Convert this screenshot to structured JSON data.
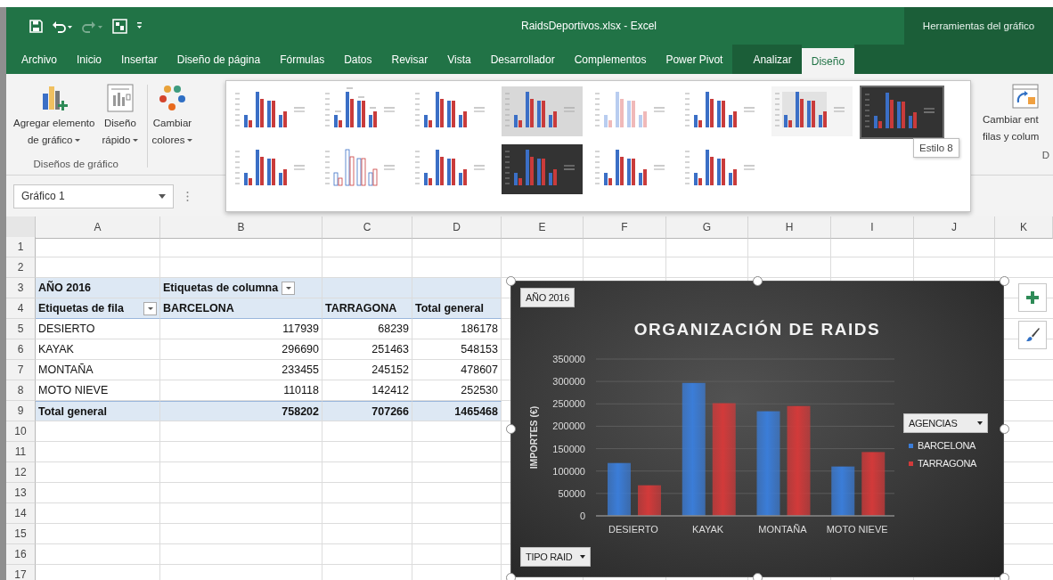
{
  "title_bar": {
    "title": "RaidsDeportivos.xlsx - Excel",
    "context_label": "Herramientas del gráfico"
  },
  "tabs": [
    {
      "label": "Archivo",
      "selected": false,
      "contextual": false
    },
    {
      "label": "Inicio",
      "selected": false,
      "contextual": false
    },
    {
      "label": "Insertar",
      "selected": false,
      "contextual": false
    },
    {
      "label": "Diseño de página",
      "selected": false,
      "contextual": false
    },
    {
      "label": "Fórmulas",
      "selected": false,
      "contextual": false
    },
    {
      "label": "Datos",
      "selected": false,
      "contextual": false
    },
    {
      "label": "Revisar",
      "selected": false,
      "contextual": false
    },
    {
      "label": "Vista",
      "selected": false,
      "contextual": false
    },
    {
      "label": "Desarrollador",
      "selected": false,
      "contextual": false
    },
    {
      "label": "Complementos",
      "selected": false,
      "contextual": false
    },
    {
      "label": "Power Pivot",
      "selected": false,
      "contextual": false
    },
    {
      "label": "Analizar",
      "selected": false,
      "contextual": true
    },
    {
      "label": "Diseño",
      "selected": true,
      "contextual": true
    }
  ],
  "ribbon": {
    "buttons": [
      {
        "kind": "add-element",
        "lines": [
          "Agregar elemento",
          "de gráfico"
        ]
      },
      {
        "kind": "quick-layout",
        "lines": [
          "Diseño",
          "rápido"
        ]
      }
    ],
    "group_label": "Diseños de gráfico",
    "colors_button": {
      "lines": [
        "Cambiar",
        "colores"
      ]
    },
    "switch_button": {
      "lines": [
        "Cambiar ent",
        "filas y colum"
      ]
    },
    "cut_group_label": "D"
  },
  "gallery": {
    "styles": [
      {
        "kind": "light",
        "selected": false
      },
      {
        "kind": "labeled",
        "selected": false
      },
      {
        "kind": "light",
        "selected": false
      },
      {
        "kind": "gradient",
        "selected": false
      },
      {
        "kind": "pale",
        "selected": false
      },
      {
        "kind": "bold",
        "selected": false
      },
      {
        "kind": "hatched",
        "selected": false
      },
      {
        "kind": "dark",
        "selected": true
      },
      {
        "kind": "light",
        "selected": false
      },
      {
        "kind": "outline",
        "selected": false
      },
      {
        "kind": "bold",
        "selected": false
      },
      {
        "kind": "dark",
        "selected": false
      },
      {
        "kind": "light",
        "selected": false
      },
      {
        "kind": "bold",
        "selected": false
      }
    ],
    "tooltip": "Estilo 8"
  },
  "formula_bar": {
    "name_box": "Gráfico 1"
  },
  "sheet": {
    "columns": [
      "A",
      "B",
      "C",
      "D",
      "E",
      "F",
      "G",
      "H",
      "I",
      "J",
      "K"
    ],
    "rows": [
      "1",
      "2",
      "3",
      "4",
      "5",
      "6",
      "7",
      "8",
      "9",
      "10",
      "11",
      "12",
      "13",
      "14",
      "15",
      "16",
      "17"
    ],
    "pivot": {
      "page_field": "AÑO 2016",
      "column_field": "Etiquetas de columna",
      "row_field": "Etiquetas de fila",
      "headers": [
        "BARCELONA",
        "TARRAGONA",
        "Total general"
      ],
      "rows": [
        {
          "label": "DESIERTO",
          "values": [
            "117939",
            "68239",
            "186178"
          ]
        },
        {
          "label": "KAYAK",
          "values": [
            "296690",
            "251463",
            "548153"
          ]
        },
        {
          "label": "MONTAÑA",
          "values": [
            "233455",
            "245152",
            "478607"
          ]
        },
        {
          "label": "MOTO NIEVE",
          "values": [
            "110118",
            "142412",
            "252530"
          ]
        }
      ],
      "total": {
        "label": "Total general",
        "values": [
          "758202",
          "707266",
          "1465468"
        ]
      }
    }
  },
  "chart": {
    "filter_button": "AÑO 2016",
    "axis_button": "TIPO RAID",
    "legend_title": "AGENCIAS",
    "chart_data": {
      "type": "bar",
      "title": "ORGANIZACIÓN DE RAIDS",
      "ylabel": "IMPORTES (€)",
      "categories": [
        "DESIERTO",
        "KAYAK",
        "MONTAÑA",
        "MOTO NIEVE"
      ],
      "series": [
        {
          "name": "BARCELONA",
          "color": "#3b7dd8",
          "values": [
            117939,
            296690,
            233455,
            110118
          ]
        },
        {
          "name": "TARRAGONA",
          "color": "#d23a3a",
          "values": [
            68239,
            251463,
            245152,
            142412
          ]
        }
      ],
      "grid": true,
      "legend": "right",
      "ylim": [
        0,
        350000
      ],
      "yticks": [
        0,
        50000,
        100000,
        150000,
        200000,
        250000,
        300000,
        350000
      ]
    }
  }
}
